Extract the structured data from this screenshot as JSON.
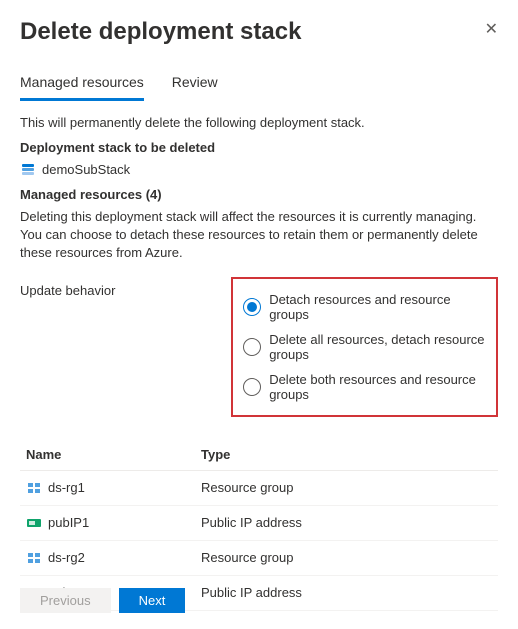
{
  "header": {
    "title": "Delete deployment stack"
  },
  "tabs": {
    "managed": "Managed resources",
    "review": "Review"
  },
  "intro": "This will permanently delete the following deployment stack.",
  "stack": {
    "section_title": "Deployment stack to be deleted",
    "name": "demoSubStack"
  },
  "managed": {
    "title": "Managed resources (4)",
    "desc": "Deleting this deployment stack will affect the resources it is currently managing. You can choose to detach these resources to retain them or permanently delete these resources from Azure."
  },
  "behavior": {
    "label": "Update behavior",
    "options": [
      "Detach resources and resource groups",
      "Delete all resources, detach resource groups",
      "Delete both resources and resource groups"
    ],
    "selected_index": 0
  },
  "table": {
    "headers": {
      "name": "Name",
      "type": "Type"
    },
    "rows": [
      {
        "name": "ds-rg1",
        "type": "Resource group",
        "icon": "resource-group"
      },
      {
        "name": "pubIP1",
        "type": "Public IP address",
        "icon": "public-ip"
      },
      {
        "name": "ds-rg2",
        "type": "Resource group",
        "icon": "resource-group"
      },
      {
        "name": "pubIP2",
        "type": "Public IP address",
        "icon": "public-ip"
      }
    ]
  },
  "footer": {
    "previous": "Previous",
    "next": "Next"
  }
}
